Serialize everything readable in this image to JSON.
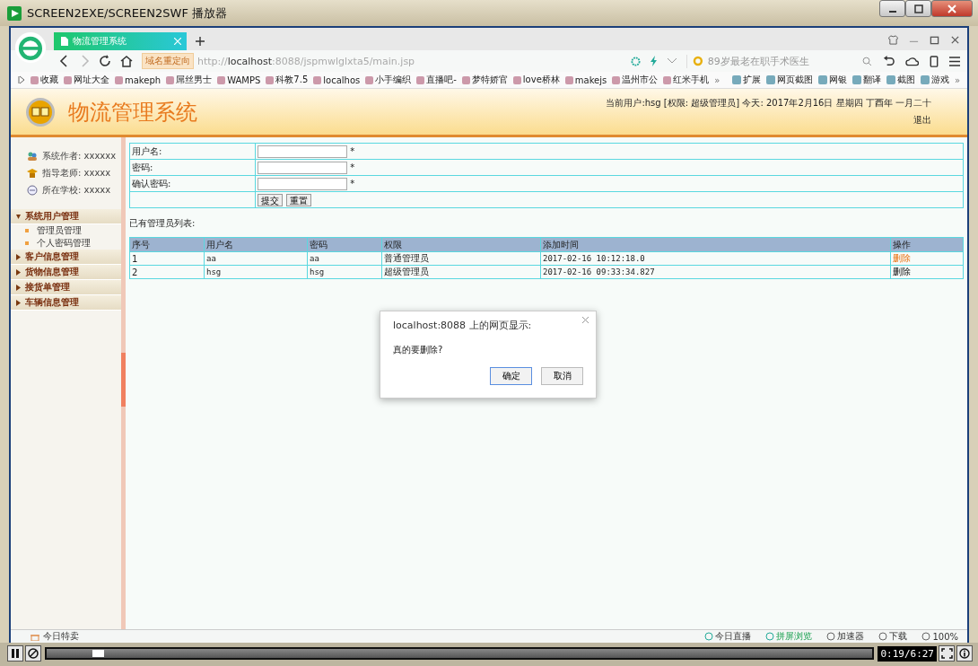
{
  "player": {
    "title": "SCREEN2EXE/SCREEN2SWF 播放器",
    "progress": {
      "level": 0.055
    },
    "time": "0:19/6:27"
  },
  "browser": {
    "tab": {
      "title": "物流管理系统"
    },
    "address": {
      "badge": "域名重定向",
      "url": "http://**localhost**:8088/jspmwlglxta5/main.jsp"
    },
    "search": {
      "placeholder": "89岁最老在职手术医生"
    },
    "bookmarks": [
      {
        "label": "收藏"
      },
      {
        "label": "网址大全"
      },
      {
        "label": "makeph"
      },
      {
        "label": "屌丝男士"
      },
      {
        "label": "WAMPS"
      },
      {
        "label": "科教7.5"
      },
      {
        "label": "localhos"
      },
      {
        "label": "小手编织"
      },
      {
        "label": "直播吧-"
      },
      {
        "label": "梦特娇官"
      },
      {
        "label": "love桥林"
      },
      {
        "label": "makejs"
      },
      {
        "label": "温州市公"
      },
      {
        "label": "红米手机"
      }
    ],
    "bookmarks_more": "»",
    "extensions": [
      {
        "label": "扩展"
      },
      {
        "label": "网页截图"
      },
      {
        "label": "网银"
      },
      {
        "label": "翻译"
      },
      {
        "label": "截图"
      },
      {
        "label": "游戏"
      }
    ],
    "extensions_more": "»"
  },
  "header": {
    "title": "物流管理系统",
    "user_info": "当前用户:hsg [权限: 超级管理员] 今天: 2017年2月16日 星期四 丁酉年 一月二十",
    "logout": "退出"
  },
  "sidebar": {
    "info": [
      {
        "label": "系统作者: xxxxxx"
      },
      {
        "label": "指导老师: xxxxx"
      },
      {
        "label": "所在学校: xxxxx"
      }
    ],
    "menu": [
      {
        "label": "系统用户管理",
        "expanded": true,
        "children": [
          {
            "label": "管理员管理"
          },
          {
            "label": "个人密码管理"
          }
        ]
      },
      {
        "label": "客户信息管理",
        "expanded": false
      },
      {
        "label": "货物信息管理",
        "expanded": false
      },
      {
        "label": "接货单管理",
        "expanded": false
      },
      {
        "label": "车辆信息管理",
        "expanded": false
      }
    ]
  },
  "form": {
    "fields": [
      {
        "label": "用户名:",
        "mark": "*"
      },
      {
        "label": "密码:",
        "mark": "*"
      },
      {
        "label": "确认密码:",
        "mark": "*"
      }
    ],
    "buttons": [
      "提交",
      "重置"
    ]
  },
  "list_title": "已有管理员列表:",
  "table": {
    "columns": [
      "序号",
      "用户名",
      "密码",
      "权限",
      "添加时间",
      "操作"
    ],
    "rows": [
      {
        "cells": [
          "1",
          "aa",
          "aa",
          "普通管理员",
          "2017-02-16 10:12:18.0"
        ],
        "action": {
          "label": "删除",
          "hovered": true
        }
      },
      {
        "cells": [
          "2",
          "hsg",
          "hsg",
          "超级管理员",
          "2017-02-16 09:33:34.827"
        ],
        "action": {
          "label": "删除",
          "hovered": false
        }
      }
    ]
  },
  "dialog": {
    "title": "localhost:8088 上的网页显示:",
    "message": "真的要删除?",
    "buttons": [
      {
        "label": "确定",
        "selected": true
      },
      {
        "label": "取消",
        "selected": false
      }
    ]
  },
  "status_bar": {
    "left": "今日特卖",
    "items": [
      {
        "label": "今日直播"
      },
      {
        "label": "拼屏浏览"
      },
      {
        "label": "加速器"
      },
      {
        "label": "下载"
      },
      {
        "label": "100%"
      }
    ]
  }
}
